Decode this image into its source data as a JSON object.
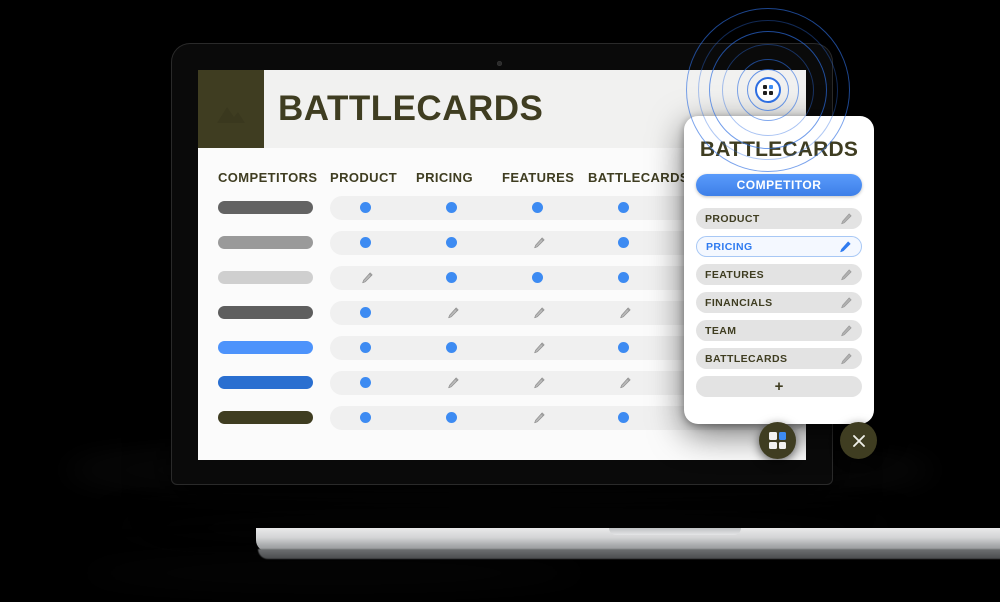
{
  "app": {
    "title": "BATTLECARDS",
    "logo_icon": "mountain-logo-icon",
    "accent_blue": "#3d8bf2",
    "brand_olive": "#3f3d21"
  },
  "table": {
    "columns": [
      "COMPETITORS",
      "PRODUCT",
      "PRICING",
      "FEATURES",
      "BATTLECARDS"
    ],
    "rows": [
      {
        "competitor_color": "#636363",
        "cells": [
          "dot",
          "dot",
          "dot",
          "dot"
        ]
      },
      {
        "competitor_color": "#9a9a9a",
        "cells": [
          "dot",
          "dot",
          "pencil",
          "dot"
        ]
      },
      {
        "competitor_color": "#cfcfcf",
        "cells": [
          "pencil",
          "dot",
          "dot",
          "dot"
        ]
      },
      {
        "competitor_color": "#5e5e5e",
        "cells": [
          "dot",
          "pencil",
          "pencil",
          "pencil"
        ]
      },
      {
        "competitor_color": "#4d93fb",
        "cells": [
          "dot",
          "dot",
          "pencil",
          "dot"
        ]
      },
      {
        "competitor_color": "#2a6fd0",
        "cells": [
          "dot",
          "pencil",
          "pencil",
          "pencil"
        ]
      },
      {
        "competitor_color": "#3f3d21",
        "cells": [
          "dot",
          "dot",
          "pencil",
          "dot"
        ]
      }
    ]
  },
  "panel": {
    "title": "BATTLECARDS",
    "competitor_label": "COMPETITOR",
    "sections": [
      {
        "label": "PRODUCT",
        "active": false,
        "edit_icon": "pencil-icon"
      },
      {
        "label": "PRICING",
        "active": true,
        "edit_icon": "pencil-icon"
      },
      {
        "label": "FEATURES",
        "active": false,
        "edit_icon": "pencil-icon"
      },
      {
        "label": "FINANCIALS",
        "active": false,
        "edit_icon": "pencil-icon"
      },
      {
        "label": "TEAM",
        "active": false,
        "edit_icon": "pencil-icon"
      },
      {
        "label": "BATTLECARDS",
        "active": false,
        "edit_icon": "pencil-icon"
      }
    ],
    "add_label": "+"
  },
  "beacon": {
    "icon": "grid-beacon-icon",
    "ring_color": "#2d6ee1"
  },
  "fabs": {
    "grid_icon": "grid-icon",
    "close_icon": "close-icon"
  }
}
